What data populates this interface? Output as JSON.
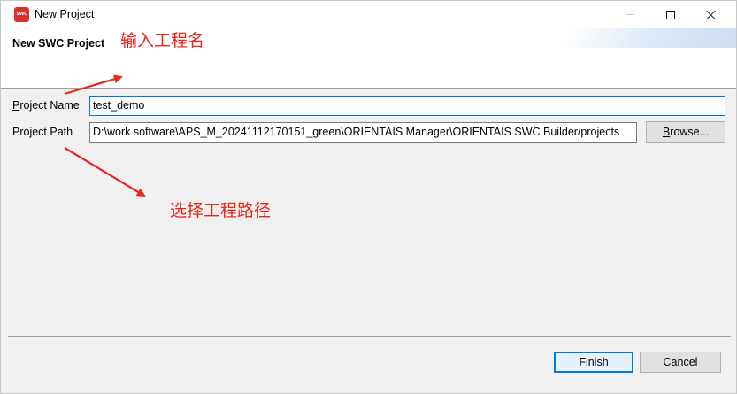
{
  "window": {
    "title": "New Project",
    "app_icon_text": "SWC",
    "icon": "swc-app-icon"
  },
  "title_controls": [
    {
      "icon": "minimize-icon"
    },
    {
      "icon": "maximize-icon"
    },
    {
      "icon": "close-icon"
    }
  ],
  "banner": {
    "title": "New SWC Project"
  },
  "annotations": {
    "name_hint": "输入工程名",
    "path_hint": "选择工程路径",
    "color": "#e8261e"
  },
  "form": {
    "project_name": {
      "label_mnemonic": "P",
      "label_rest": "roject Name",
      "value": "test_demo"
    },
    "project_path": {
      "label": "Project Path",
      "value": "D:\\work software\\APS_M_20241112170151_green\\ORIENTAIS Manager\\ORIENTAIS SWC Builder/projects",
      "browse_mnemonic": "B",
      "browse_rest": "rowse..."
    }
  },
  "footer": {
    "finish_mnemonic": "F",
    "finish_rest": "inish",
    "cancel_label": "Cancel"
  }
}
